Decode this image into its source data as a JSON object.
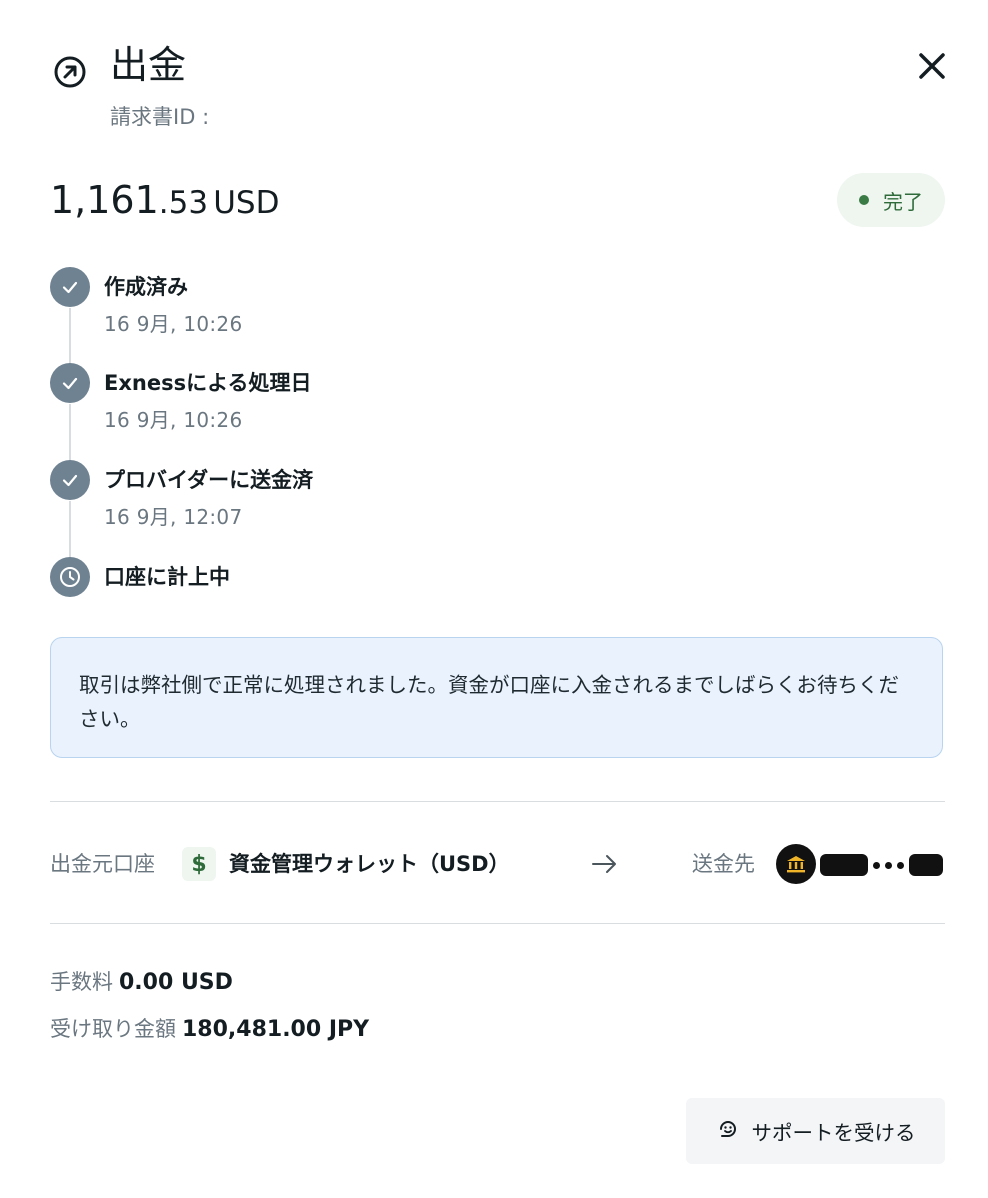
{
  "header": {
    "icon": "arrow-up-right-circle-icon",
    "title": "出金",
    "invoice_label": "請求書ID",
    "invoice_partial": ":",
    "close_icon": "close-icon"
  },
  "amount": {
    "integer": "1,161",
    "decimal": ".53",
    "currency": "USD"
  },
  "status": {
    "label": "完了",
    "color": "#3a7a45"
  },
  "timeline": [
    {
      "title": "作成済み",
      "time": "16 9月, 10:26",
      "state": "done"
    },
    {
      "title": "Exnessによる処理日",
      "time": "16 9月, 10:26",
      "state": "done"
    },
    {
      "title": "プロバイダーに送金済",
      "time": "16 9月, 12:07",
      "state": "done"
    },
    {
      "title": "口座に計上中",
      "state": "pending"
    }
  ],
  "info_message": "取引は弊社側で正常に処理されました。資金が口座に入金されるまでしばらくお待ちください。",
  "transfer": {
    "source_label": "出金元口座",
    "source_icon": "dollar-icon",
    "source_name": "資金管理ウォレット（USD）",
    "arrow_icon": "arrow-right-icon",
    "destination_label": "送金先",
    "destination_icon": "bank-icon"
  },
  "fees": {
    "fee_label": "手数料",
    "fee_value": "0.00 USD",
    "received_label": "受け取り金額",
    "received_value": "180,481.00 JPY"
  },
  "support_button": {
    "label": "サポートを受ける",
    "icon": "support-icon"
  }
}
